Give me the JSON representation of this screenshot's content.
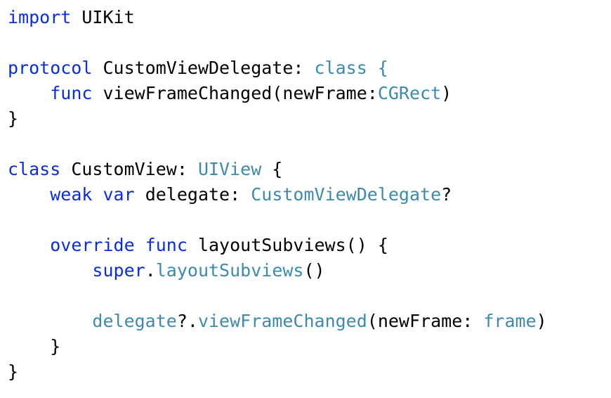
{
  "editor": {
    "lines": [
      {
        "tokens": [
          {
            "text": "import",
            "kind": "keyword"
          },
          {
            "text": " UIKit",
            "kind": "plain"
          }
        ]
      },
      {
        "tokens": []
      },
      {
        "tokens": [
          {
            "text": "protocol",
            "kind": "keyword"
          },
          {
            "text": " CustomViewDelegate: ",
            "kind": "plain"
          },
          {
            "text": "class {",
            "kind": "type"
          }
        ]
      },
      {
        "tokens": [
          {
            "text": "    ",
            "kind": "plain"
          },
          {
            "text": "func",
            "kind": "keyword"
          },
          {
            "text": " viewFrameChanged(newFrame:",
            "kind": "plain"
          },
          {
            "text": "CGRect",
            "kind": "type"
          },
          {
            "text": ")",
            "kind": "plain"
          }
        ]
      },
      {
        "tokens": [
          {
            "text": "}",
            "kind": "plain"
          }
        ]
      },
      {
        "tokens": []
      },
      {
        "tokens": [
          {
            "text": "class",
            "kind": "keyword"
          },
          {
            "text": " CustomView: ",
            "kind": "plain"
          },
          {
            "text": "UIView",
            "kind": "type"
          },
          {
            "text": " {",
            "kind": "plain"
          }
        ]
      },
      {
        "tokens": [
          {
            "text": "    ",
            "kind": "plain"
          },
          {
            "text": "weak var",
            "kind": "keyword"
          },
          {
            "text": " delegate: ",
            "kind": "plain"
          },
          {
            "text": "CustomViewDelegate",
            "kind": "type"
          },
          {
            "text": "?",
            "kind": "plain"
          }
        ]
      },
      {
        "tokens": []
      },
      {
        "tokens": [
          {
            "text": "    ",
            "kind": "plain"
          },
          {
            "text": "override func",
            "kind": "keyword"
          },
          {
            "text": " layoutSubviews() {",
            "kind": "plain"
          }
        ]
      },
      {
        "tokens": [
          {
            "text": "        ",
            "kind": "plain"
          },
          {
            "text": "super",
            "kind": "keyword"
          },
          {
            "text": ".",
            "kind": "plain"
          },
          {
            "text": "layoutSubviews",
            "kind": "type"
          },
          {
            "text": "()",
            "kind": "plain"
          }
        ]
      },
      {
        "tokens": []
      },
      {
        "tokens": [
          {
            "text": "        ",
            "kind": "plain"
          },
          {
            "text": "delegate",
            "kind": "type"
          },
          {
            "text": "?.",
            "kind": "plain"
          },
          {
            "text": "viewFrameChanged",
            "kind": "type"
          },
          {
            "text": "(newFrame: ",
            "kind": "plain"
          },
          {
            "text": "frame",
            "kind": "type"
          },
          {
            "text": ")",
            "kind": "plain"
          }
        ]
      },
      {
        "tokens": [
          {
            "text": "    }",
            "kind": "plain"
          }
        ]
      },
      {
        "tokens": [
          {
            "text": "}",
            "kind": "plain"
          }
        ]
      }
    ],
    "colors": {
      "keyword": "#0b2fd1",
      "type": "#3e8aa8",
      "plain": "#000000",
      "background": "#ffffff"
    }
  }
}
